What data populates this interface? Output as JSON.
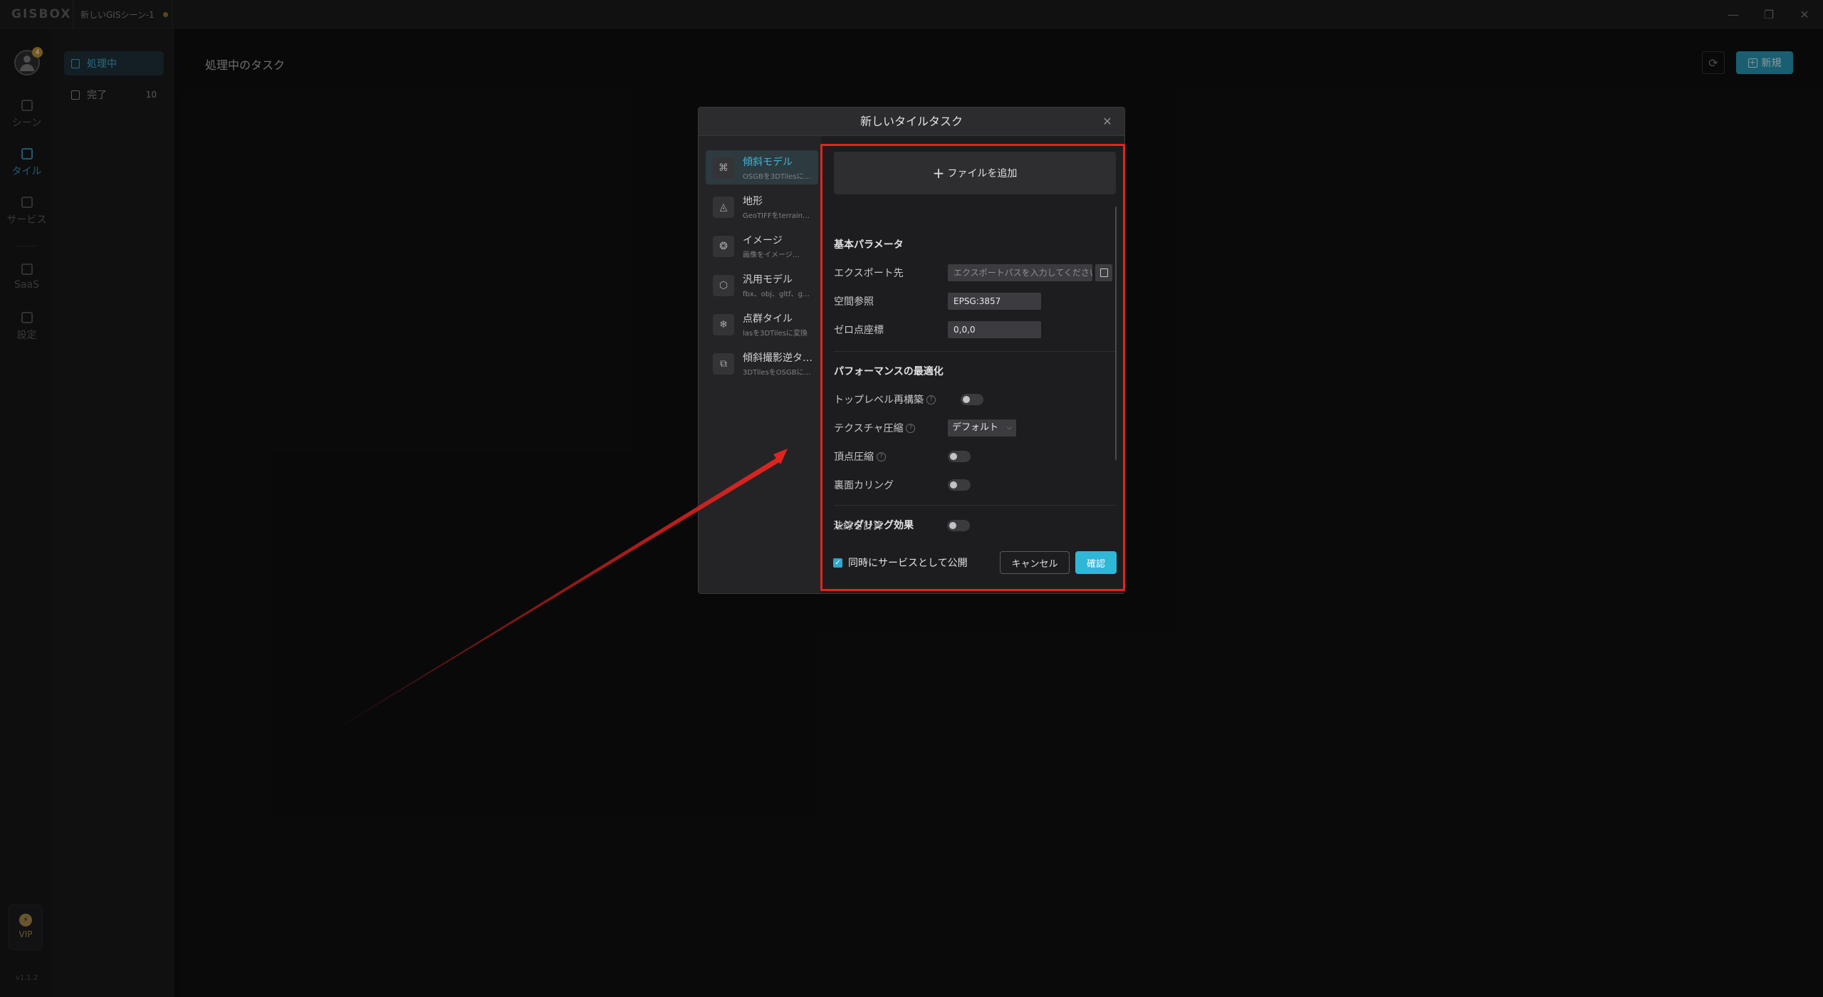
{
  "titlebar": {
    "brand": "GISBOX",
    "doc_tab": "新しいGISシーン-1",
    "minimize": "—",
    "restore": "❐",
    "close": "✕"
  },
  "rail": {
    "avatar_badge": "4",
    "items": [
      {
        "label": "シーン",
        "active": false
      },
      {
        "label": "タイル",
        "active": true
      },
      {
        "label": "サービス",
        "active": false
      },
      {
        "label": "SaaS",
        "active": false
      },
      {
        "label": "設定",
        "active": false
      }
    ],
    "vip": "VIP",
    "version": "v1.1.2"
  },
  "subnav": {
    "processing": "処理中",
    "done": "完了",
    "done_count": "10"
  },
  "main": {
    "title": "処理中のタスク",
    "new_button": "新規"
  },
  "modal": {
    "title": "新しいタイルタスク",
    "types": [
      {
        "name": "傾斜モデル",
        "desc": "OSGBを3DTilesに…",
        "icon": "⌘",
        "active": true
      },
      {
        "name": "地形",
        "desc": "GeoTIFFをterrain…",
        "icon": "◬",
        "active": false
      },
      {
        "name": "イメージ",
        "desc": "画像をイメージ…",
        "icon": "❂",
        "active": false
      },
      {
        "name": "汎用モデル",
        "desc": "fbx、obj、gltf、g…",
        "icon": "⬡",
        "active": false
      },
      {
        "name": "点群タイル",
        "desc": "lasを3DTilesに変換",
        "icon": "❄",
        "active": false
      },
      {
        "name": "傾斜撮影逆タ…",
        "desc": "3DTilesをOSGBに…",
        "icon": "⧉",
        "active": false
      }
    ],
    "add_file": "ファイルを追加",
    "basic_section": "基本パラメータ",
    "export_label": "エクスポート先",
    "export_placeholder": "エクスポートパスを入力してください",
    "srs_label": "空間参照",
    "srs_value": "EPSG:3857",
    "origin_label": "ゼロ点座標",
    "origin_value": "0,0,0",
    "perf_section": "パフォーマンスの最適化",
    "top_rebuild_label": "トップレベル再構築",
    "texture_label": "テクスチャ圧縮",
    "texture_value": "デフォルト",
    "vertex_label": "頂点圧縮",
    "backface_label": "裏面カリング",
    "render_section": "レンダリング効果",
    "normals_label": "法線を計算",
    "publish_label": "同時にサービスとして公開",
    "cancel": "キャンセル",
    "confirm": "確認",
    "toggles": {
      "top_rebuild": false,
      "vertex": false,
      "backface": false,
      "normals": false
    },
    "publish_checked": true
  },
  "colors": {
    "accent": "#2fb7d8",
    "annotation": "#e12420"
  }
}
